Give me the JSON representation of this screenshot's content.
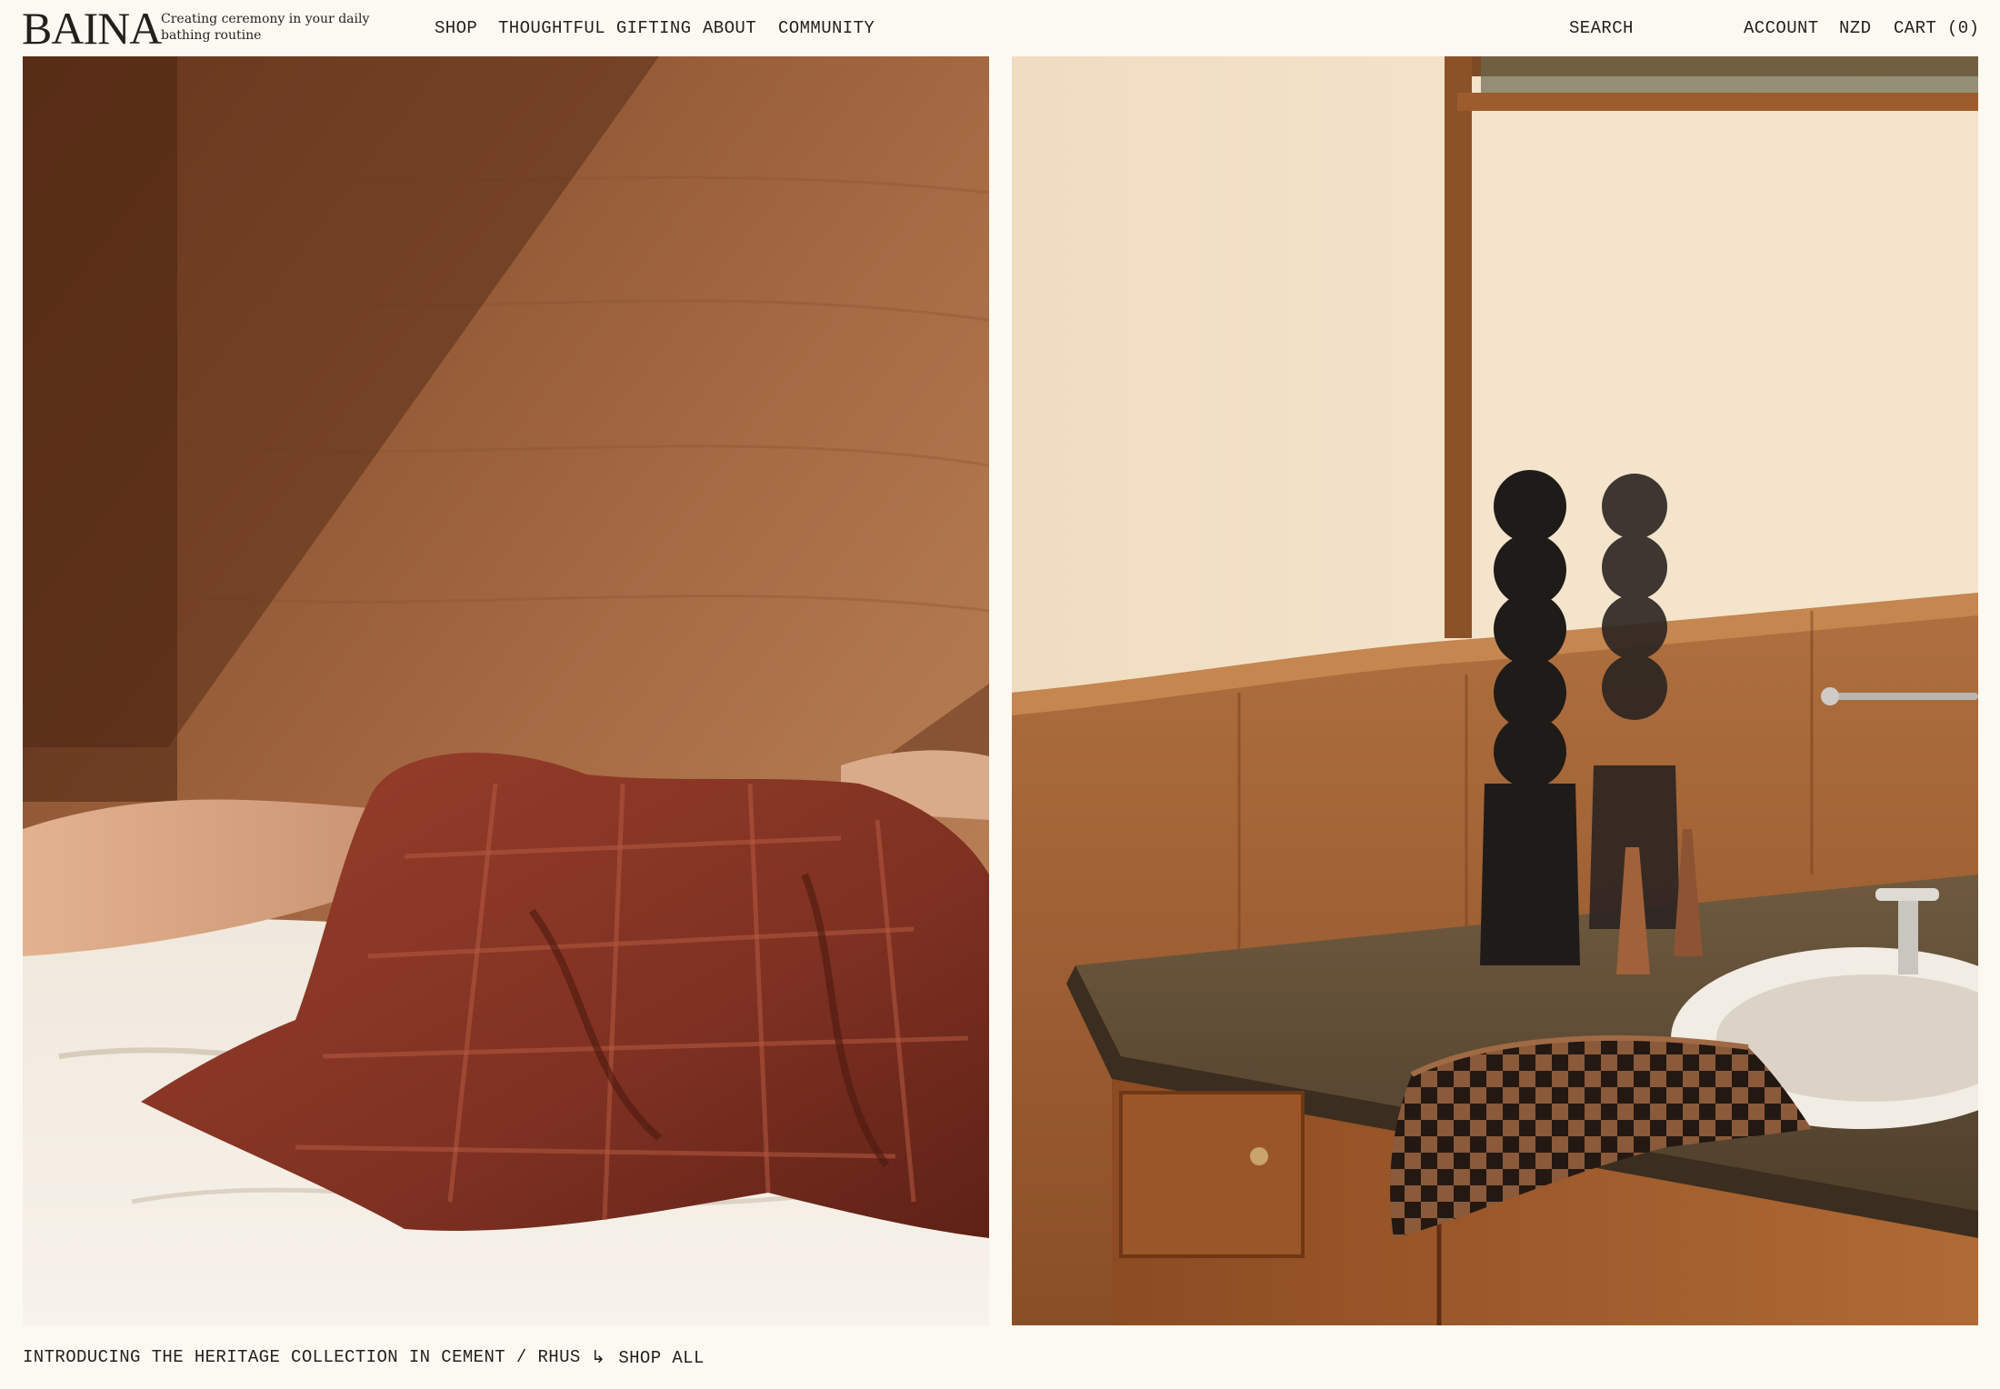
{
  "header": {
    "logo": "BAINA",
    "tagline": "Creating ceremony in your daily bathing routine",
    "nav": {
      "shop": "SHOP",
      "gifting": "THOUGHTFUL GIFTING",
      "about": "ABOUT",
      "community": "COMMUNITY"
    },
    "utility": {
      "search": "SEARCH",
      "account": "ACCOUNT",
      "currency": "NZD",
      "cart": "CART (0)"
    }
  },
  "hero": {
    "caption": "INTRODUCING THE HERITAGE COLLECTION IN CEMENT / RHUS",
    "cta_icon": "turn-right-arrow-icon",
    "cta_label": "SHOP ALL"
  },
  "colors": {
    "background": "#fcf9f3",
    "text": "#231f1c",
    "towel_rhus": "#8a3627",
    "wood": "#a0673d"
  }
}
